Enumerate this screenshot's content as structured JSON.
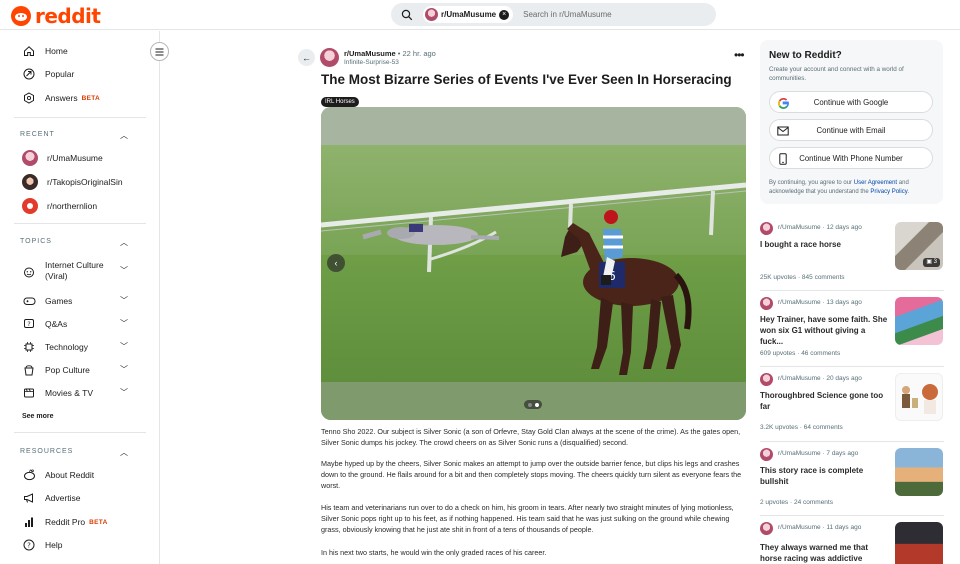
{
  "header": {
    "logo_text": "reddit",
    "search": {
      "chip_label": "r/UmaMusume",
      "chip_close": "×",
      "placeholder": "Search in r/UmaMusume"
    }
  },
  "sidebar": {
    "primary": [
      {
        "label": "Home",
        "icon": "home-icon"
      },
      {
        "label": "Popular",
        "icon": "popular-icon"
      },
      {
        "label": "Answers",
        "badge": "BETA",
        "icon": "answers-icon"
      }
    ],
    "recent": {
      "heading": "RECENT",
      "items": [
        {
          "label": "r/UmaMusume",
          "color": "#b14b6a"
        },
        {
          "label": "r/TakopisOriginalSin",
          "color": "#3a2a2a"
        },
        {
          "label": "r/northernlion",
          "color": "#e23b2e"
        }
      ]
    },
    "topics": {
      "heading": "TOPICS",
      "items": [
        {
          "label": "Internet Culture (Viral)",
          "icon": "internet-culture-icon"
        },
        {
          "label": "Games",
          "icon": "games-icon"
        },
        {
          "label": "Q&As",
          "icon": "qa-icon"
        },
        {
          "label": "Technology",
          "icon": "technology-icon"
        },
        {
          "label": "Pop Culture",
          "icon": "pop-culture-icon"
        },
        {
          "label": "Movies & TV",
          "icon": "movies-icon"
        }
      ],
      "see_more": "See more"
    },
    "resources": {
      "heading": "RESOURCES",
      "items": [
        {
          "label": "About Reddit",
          "icon": "about-reddit-icon"
        },
        {
          "label": "Advertise",
          "icon": "advertise-icon"
        },
        {
          "label": "Reddit Pro",
          "badge": "BETA",
          "icon": "reddit-pro-icon"
        },
        {
          "label": "Help",
          "icon": "help-icon"
        }
      ]
    }
  },
  "post": {
    "subreddit": "r/UmaMusume",
    "time": "• 22 hr. ago",
    "author": "Infinite-Surprise-53",
    "title": "The Most Bizarre Series of Events I've Ever Seen In Horseracing",
    "flair": "IRL Horses",
    "media": {
      "slides": 2,
      "active_slide": 2,
      "horse_number": "6"
    },
    "paragraphs": [
      "Tenno Sho 2022. Our subject is Silver Sonic (a son of Orfevre, Stay Gold Clan always at the scene of the crime). As the gates open, Silver Sonic dumps his jockey. The crowd cheers on as Silver Sonic runs a (disqualified) second.",
      "Maybe hyped up by the cheers, Silver Sonic makes an attempt to jump over the outside barrier fence, but clips his legs and crashes down to the ground. He flails around for a bit and then completely stops moving. The cheers quickly turn silent as everyone fears the worst.",
      "His team and veterinarians run over to do a check on him, his groom in tears. After nearly two straight minutes of lying motionless, Silver Sonic pops right up to his feet, as if nothing happened. His team said that he was just sulking on the ground while chewing grass, obviously knowing that he just ate shit in front of a tens of thousands of people.",
      "In his next two starts, he would win the only graded races of his career."
    ]
  },
  "signup": {
    "title": "New to Reddit?",
    "subtitle": "Create your account and connect with a world of communities.",
    "buttons": [
      {
        "label": "Continue with Google",
        "icon": "google-icon"
      },
      {
        "label": "Continue with Email",
        "icon": "email-icon"
      },
      {
        "label": "Continue With Phone Number",
        "icon": "phone-icon"
      }
    ],
    "legal_prefix": "By continuing, you agree to our",
    "legal_link1": "User Agreement",
    "legal_mid": "and acknowledge that you understand the",
    "legal_link2": "Privacy Policy",
    "legal_end": "."
  },
  "recommended": [
    {
      "sub": "r/UmaMusume · 12 days ago",
      "title": "I bought a race horse",
      "stats": "25K upvotes · 845 comments",
      "thumb_badge": "3"
    },
    {
      "sub": "r/UmaMusume · 13 days ago",
      "title": "Hey Trainer, have some faith. She won six G1 without giving a fuck...",
      "stats": "609 upvotes · 46 comments"
    },
    {
      "sub": "r/UmaMusume · 20 days ago",
      "title": "Thoroughbred Science gone too far",
      "stats": "3.2K upvotes · 64 comments"
    },
    {
      "sub": "r/UmaMusume · 7 days ago",
      "title": "This story race is complete bullshit",
      "stats": "2 upvotes · 24 comments"
    },
    {
      "sub": "r/UmaMusume · 11 days ago",
      "title": "They always warned me that horse racing was addictive",
      "stats": ""
    }
  ],
  "colors": {
    "brand": "#ff4500",
    "beta": "#d93a00",
    "link": "#0045ac"
  }
}
